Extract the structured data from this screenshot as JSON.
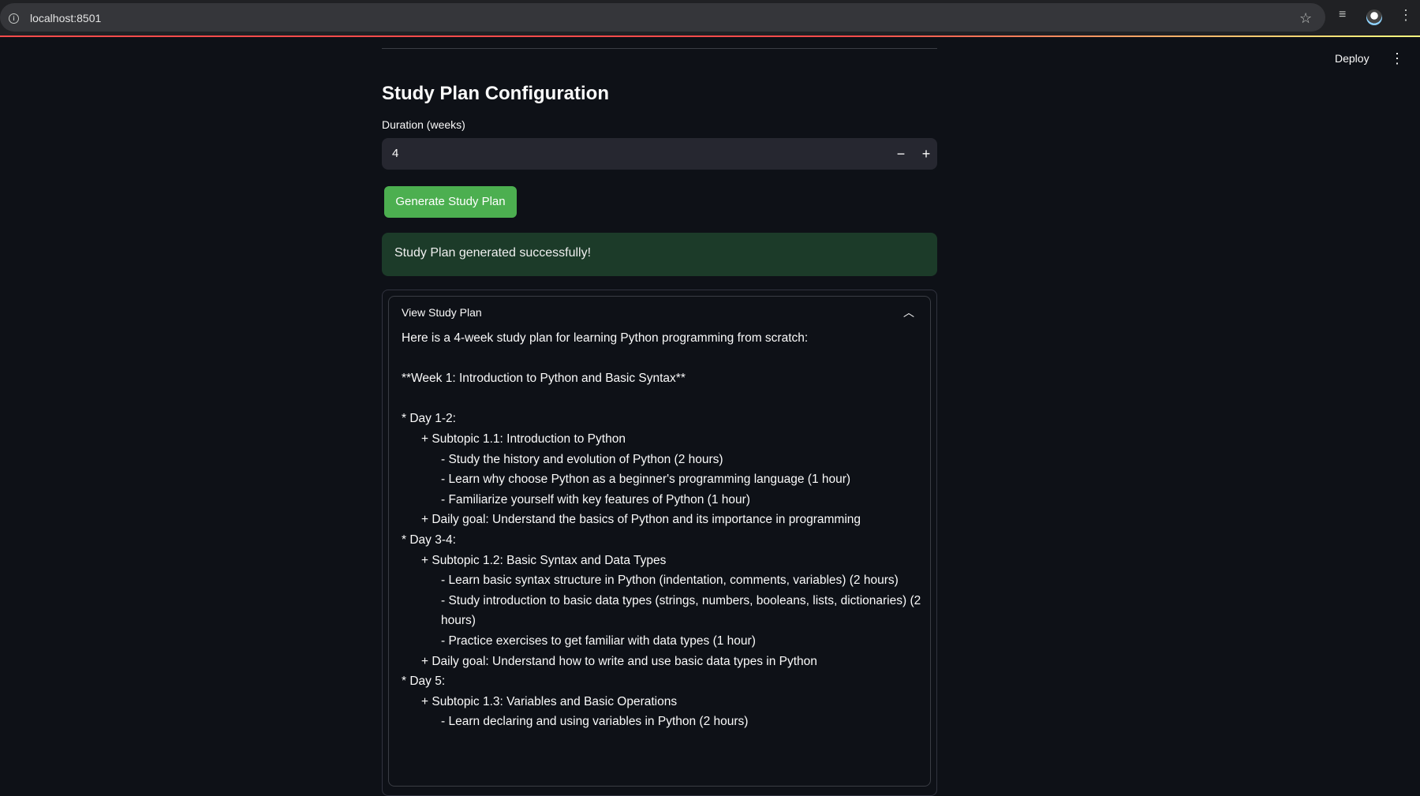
{
  "browser": {
    "url": "localhost:8501",
    "icons": [
      "info-icon",
      "star-icon",
      "media-icon",
      "profile-icon",
      "menu-icon"
    ]
  },
  "header": {
    "deploy_label": "Deploy"
  },
  "main": {
    "title": "Study Plan Configuration",
    "duration_label": "Duration (weeks)",
    "duration_value": "4",
    "minus_label": "−",
    "plus_label": "+",
    "generate_button": "Generate Study Plan",
    "success_message": "Study Plan generated successfully!",
    "expander": {
      "label": "View Study Plan",
      "lines": [
        "Here is a 4-week study plan for learning Python programming from scratch:",
        "",
        "**Week 1: Introduction to Python and Basic Syntax**",
        "",
        "* Day 1-2:",
        "\t+ Subtopic 1.1: Introduction to Python",
        "\t\t- Study the history and evolution of Python (2 hours)",
        "\t\t- Learn why choose Python as a beginner's programming language (1 hour)",
        "\t\t- Familiarize yourself with key features of Python (1 hour)",
        "\t+ Daily goal: Understand the basics of Python and its importance in programming",
        "* Day 3-4:",
        "\t+ Subtopic 1.2: Basic Syntax and Data Types",
        "\t\t- Learn basic syntax structure in Python (indentation, comments, variables) (2 hours)",
        "\t\t- Study introduction to basic data types (strings, numbers, booleans, lists, dictionaries) (2 hours)",
        "\t\t- Practice exercises to get familiar with data types (1 hour)",
        "\t+ Daily goal: Understand how to write and use basic data types in Python",
        "* Day 5:",
        "\t+ Subtopic 1.3: Variables and Basic Operations",
        "\t\t- Learn declaring and using variables in Python (2 hours)"
      ]
    }
  }
}
